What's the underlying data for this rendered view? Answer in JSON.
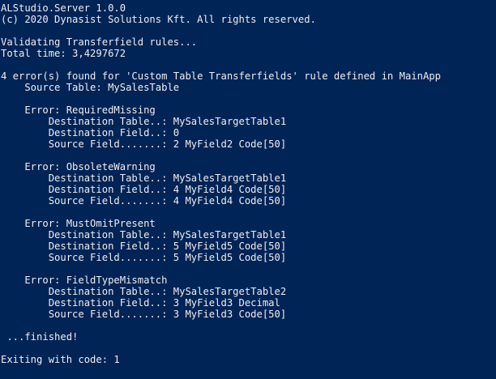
{
  "console": {
    "lines": [
      "ALStudio.Server 1.0.0",
      "(c) 2020 Dynasist Solutions Kft. All rights reserved.",
      "",
      "Validating Transferfield rules...",
      "Total time: 3,4297672",
      "",
      "4 error(s) found for 'Custom Table Transferfields' rule defined in MainApp",
      "    Source Table: MySalesTable",
      "",
      "    Error: RequiredMissing",
      "        Destination Table..: MySalesTargetTable1",
      "        Destination Field..: 0",
      "        Source Field.......: 2 MyField2 Code[50]",
      "",
      "    Error: ObsoleteWarning",
      "        Destination Table..: MySalesTargetTable1",
      "        Destination Field..: 4 MyField4 Code[50]",
      "        Source Field.......: 4 MyField4 Code[50]",
      "",
      "    Error: MustOmitPresent",
      "        Destination Table..: MySalesTargetTable1",
      "        Destination Field..: 5 MyField5 Code[50]",
      "        Source Field.......: 5 MyField5 Code[50]",
      "",
      "    Error: FieldTypeMismatch",
      "        Destination Table..: MySalesTargetTable2",
      "        Destination Field..: 3 MyField3 Decimal",
      "        Source Field.......: 3 MyField3 Code[50]",
      "",
      " ...finished!",
      "",
      "Exiting with code: 1"
    ]
  },
  "colors": {
    "background": "#012456",
    "foreground": "#eeedf0"
  }
}
